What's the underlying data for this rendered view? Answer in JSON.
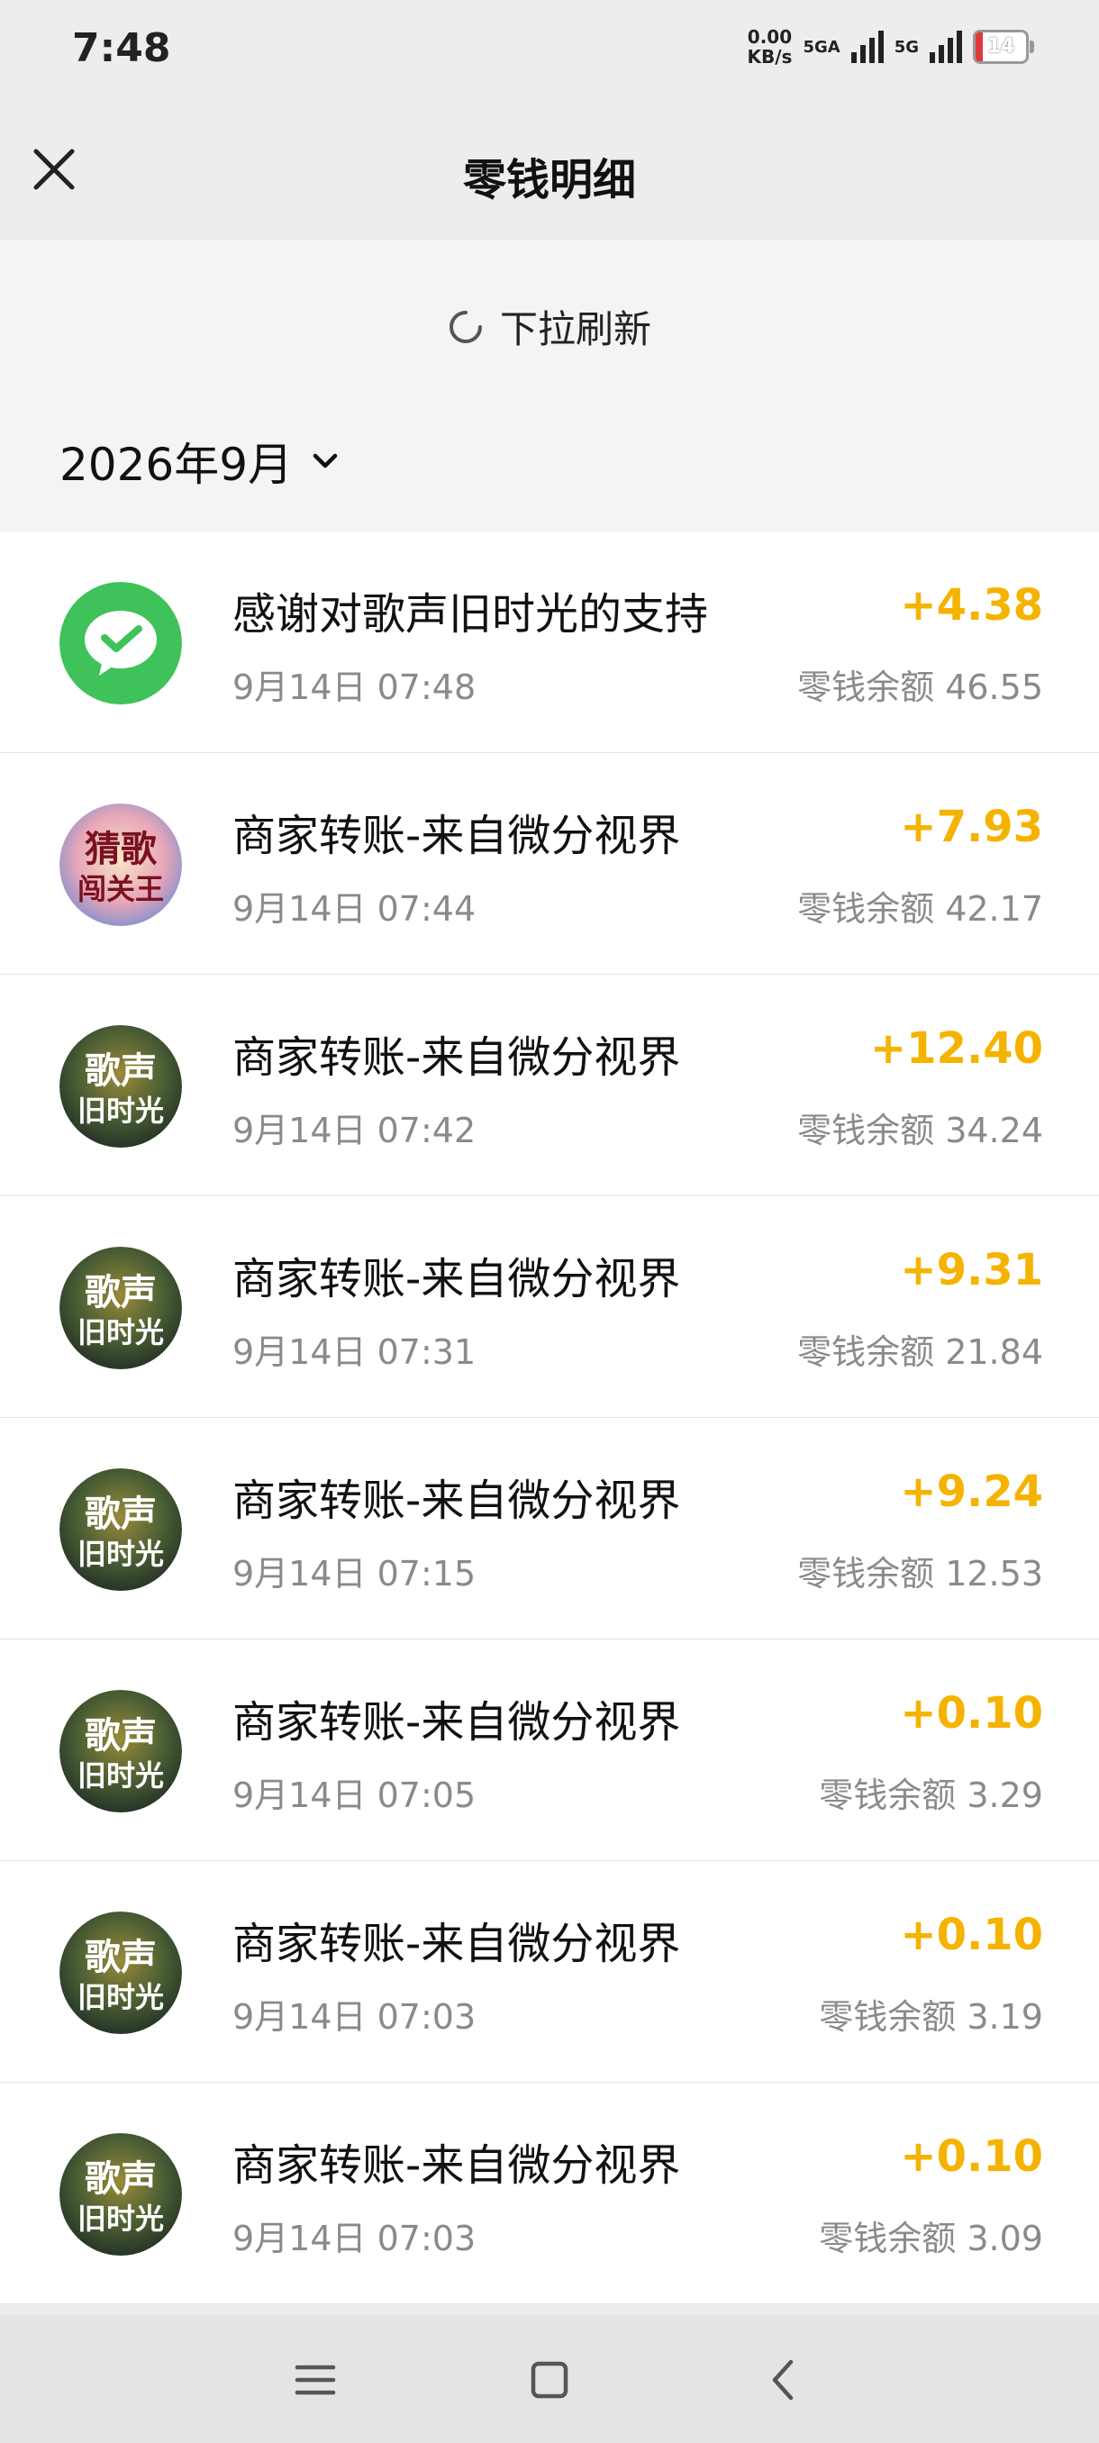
{
  "status": {
    "time": "7:48",
    "speed_value": "0.00",
    "speed_unit": "KB/s",
    "sim1_label": "5GA",
    "sim2_label": "5G",
    "battery": "14"
  },
  "nav": {
    "title": "零钱明细"
  },
  "refresh": {
    "text": "下拉刷新"
  },
  "month": {
    "label": "2026年9月"
  },
  "balance_label": "零钱余额",
  "rows": [
    {
      "title": "感谢对歌声旧时光的支持",
      "time": "9月14日 07:48",
      "amount": "+4.38",
      "balance": "零钱余额 46.55",
      "avatar": "wechat-pay-logo"
    },
    {
      "title": "商家转账-来自微分视界",
      "time": "9月14日 07:44",
      "amount": "+7.93",
      "balance": "零钱余额 42.17",
      "avatar": "guess-song-avatar",
      "avatar_line1": "猜歌",
      "avatar_line2": "闯关王"
    },
    {
      "title": "商家转账-来自微分视界",
      "time": "9月14日 07:42",
      "amount": "+12.40",
      "balance": "零钱余额 34.24",
      "avatar": "song-avatar",
      "avatar_line1": "歌声",
      "avatar_line2": "旧时光"
    },
    {
      "title": "商家转账-来自微分视界",
      "time": "9月14日 07:31",
      "amount": "+9.31",
      "balance": "零钱余额 21.84",
      "avatar": "song-avatar",
      "avatar_line1": "歌声",
      "avatar_line2": "旧时光"
    },
    {
      "title": "商家转账-来自微分视界",
      "time": "9月14日 07:15",
      "amount": "+9.24",
      "balance": "零钱余额 12.53",
      "avatar": "song-avatar",
      "avatar_line1": "歌声",
      "avatar_line2": "旧时光"
    },
    {
      "title": "商家转账-来自微分视界",
      "time": "9月14日 07:05",
      "amount": "+0.10",
      "balance": "零钱余额 3.29",
      "avatar": "song-avatar",
      "avatar_line1": "歌声",
      "avatar_line2": "旧时光"
    },
    {
      "title": "商家转账-来自微分视界",
      "time": "9月14日 07:03",
      "amount": "+0.10",
      "balance": "零钱余额 3.19",
      "avatar": "song-avatar",
      "avatar_line1": "歌声",
      "avatar_line2": "旧时光"
    },
    {
      "title": "商家转账-来自微分视界",
      "time": "9月14日 07:03",
      "amount": "+0.10",
      "balance": "零钱余额 3.09",
      "avatar": "song-avatar",
      "avatar_line1": "歌声",
      "avatar_line2": "旧时光"
    }
  ],
  "colors": {
    "amount": "#f5b300",
    "wechat_green": "#3fc25a",
    "background": "#ededed"
  },
  "bottom_nav": {
    "icons": [
      "menu-icon",
      "home-icon",
      "back-icon"
    ]
  }
}
